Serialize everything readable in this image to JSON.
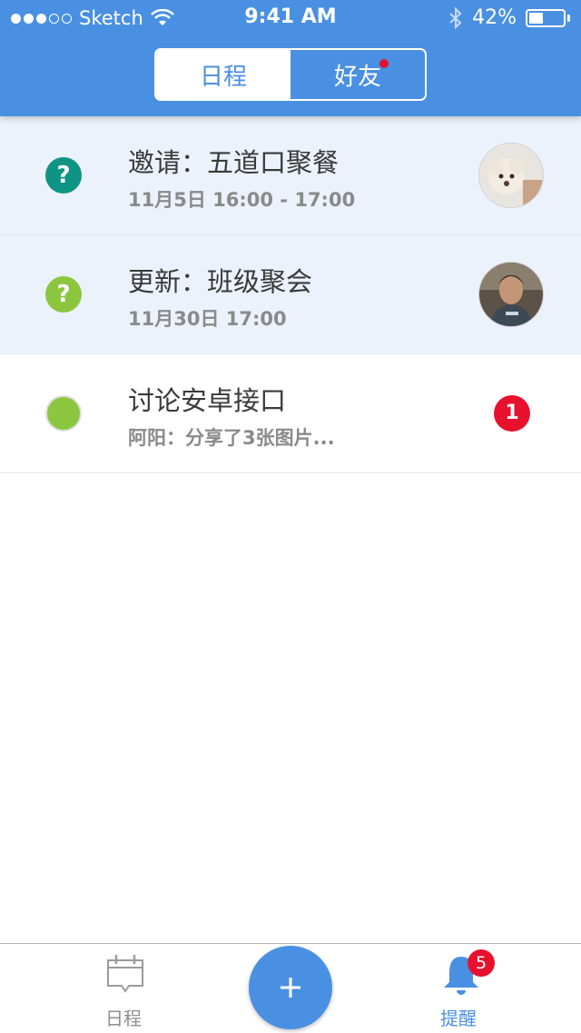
{
  "status_bar": {
    "carrier": "Sketch",
    "time": "9:41 AM",
    "battery_percent": "42%",
    "battery_level": 0.42,
    "signal_bars_filled": 3,
    "signal_bars_total": 5,
    "icons": [
      "signal-dots-icon",
      "wifi-icon",
      "bluetooth-icon",
      "battery-icon"
    ]
  },
  "header": {
    "tabs": [
      {
        "label": "日程",
        "active": true
      },
      {
        "label": "好友",
        "active": false,
        "has_dot": true
      }
    ],
    "colors": {
      "primary": "#4a90e2",
      "notification_dot": "#e8112d"
    }
  },
  "notifications": [
    {
      "title": "邀请：五道口聚餐",
      "subtitle": "11月5日  16:00 - 17:00",
      "status_icon": "question-icon",
      "status_color": "#0e9484",
      "unread": true,
      "right": "avatar-dog"
    },
    {
      "title": "更新：班级聚会",
      "subtitle": "11月30日  17:00",
      "status_icon": "question-icon",
      "status_color": "#8cc63f",
      "unread": true,
      "right": "avatar-man"
    },
    {
      "title": "讨论安卓接口",
      "subtitle": "阿阳：分享了3张图片...",
      "status_icon": "dot-icon",
      "status_color": "#8cc63f",
      "unread": false,
      "badge": "1"
    }
  ],
  "tabbar": {
    "items": [
      {
        "label": "日程",
        "icon": "calendar-icon",
        "active": false
      },
      {
        "label": "提醒",
        "icon": "bell-icon",
        "active": true,
        "badge": "5"
      }
    ],
    "fab_icon": "plus-icon"
  }
}
